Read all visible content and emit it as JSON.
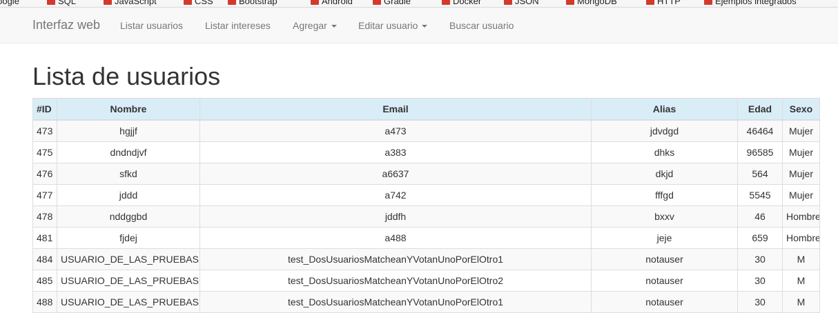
{
  "bookmarks": [
    {
      "label": "Google",
      "icon": "bookmark-icon"
    },
    {
      "label": "SQL",
      "icon": "bookmark-icon"
    },
    {
      "label": "JavaScript",
      "icon": "bookmark-icon"
    },
    {
      "label": "CSS",
      "icon": "bookmark-icon"
    },
    {
      "label": "Bootstrap",
      "icon": "bookmark-icon"
    },
    {
      "label": "Android",
      "icon": "bookmark-icon"
    },
    {
      "label": "Gradle",
      "icon": "bookmark-icon"
    },
    {
      "label": "Docker",
      "icon": "bookmark-icon"
    },
    {
      "label": "JSON",
      "icon": "bookmark-icon"
    },
    {
      "label": "MongoDB",
      "icon": "bookmark-icon"
    },
    {
      "label": "HTTP",
      "icon": "bookmark-icon"
    },
    {
      "label": "Ejemplos integrados",
      "icon": "bookmark-icon"
    }
  ],
  "navbar": {
    "brand": "Interfaz web",
    "items": [
      {
        "label": "Listar usuarios",
        "dropdown": false
      },
      {
        "label": "Listar intereses",
        "dropdown": false
      },
      {
        "label": "Agregar",
        "dropdown": true
      },
      {
        "label": "Editar usuario",
        "dropdown": true
      },
      {
        "label": "Buscar usuario",
        "dropdown": false
      }
    ]
  },
  "page": {
    "title": "Lista de usuarios"
  },
  "table": {
    "headers": [
      "#ID",
      "Nombre",
      "Email",
      "Alias",
      "Edad",
      "Sexo"
    ],
    "rows": [
      [
        "473",
        "hgjjf",
        "a473",
        "jdvdgd",
        "46464",
        "Mujer"
      ],
      [
        "475",
        "dndndjvf",
        "a383",
        "dhks",
        "96585",
        "Mujer"
      ],
      [
        "476",
        "sfkd",
        "a6637",
        "dkjd",
        "564",
        "Mujer"
      ],
      [
        "477",
        "jddd",
        "a742",
        "fffgd",
        "5545",
        "Mujer"
      ],
      [
        "478",
        "nddggbd",
        "jddfh",
        "bxxv",
        "46",
        "Hombre"
      ],
      [
        "481",
        "fjdej",
        "a488",
        "jeje",
        "659",
        "Hombre"
      ],
      [
        "484",
        "USUARIO_DE_LAS_PRUEBAS",
        "test_DosUsuariosMatcheanYVotanUnoPorElOtro1",
        "notauser",
        "30",
        "M"
      ],
      [
        "485",
        "USUARIO_DE_LAS_PRUEBAS",
        "test_DosUsuariosMatcheanYVotanUnoPorElOtro2",
        "notauser",
        "30",
        "M"
      ],
      [
        "488",
        "USUARIO_DE_LAS_PRUEBAS",
        "test_DosUsuariosMatcheanYVotanUnoPorElOtro1",
        "notauser",
        "30",
        "M"
      ]
    ]
  },
  "colors": {
    "header_bg": "#d9edf7",
    "navbar_bg": "#f8f8f8",
    "bookmark_icon": "#d33a2c"
  }
}
